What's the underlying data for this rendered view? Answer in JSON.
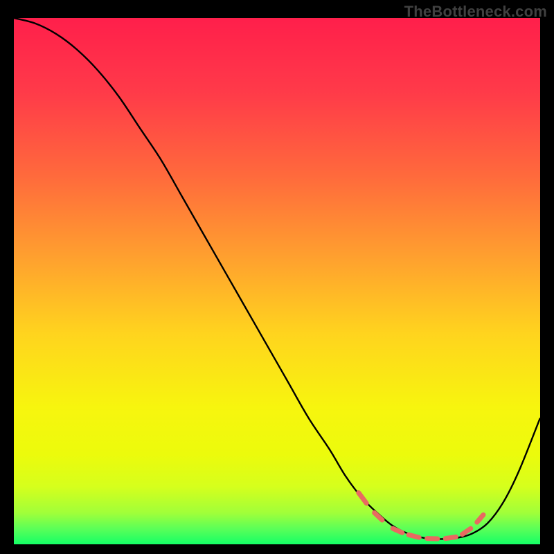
{
  "watermark": "TheBottleneck.com",
  "gradient_stops": [
    {
      "offset": 0,
      "color": "#ff1f4b"
    },
    {
      "offset": 14,
      "color": "#ff3a49"
    },
    {
      "offset": 30,
      "color": "#ff6a3c"
    },
    {
      "offset": 46,
      "color": "#ffa22e"
    },
    {
      "offset": 60,
      "color": "#ffd41e"
    },
    {
      "offset": 74,
      "color": "#f7f50e"
    },
    {
      "offset": 83,
      "color": "#ecfb0c"
    },
    {
      "offset": 89,
      "color": "#d6ff1c"
    },
    {
      "offset": 94,
      "color": "#a1ff39"
    },
    {
      "offset": 97,
      "color": "#5cff58"
    },
    {
      "offset": 100,
      "color": "#14ff66"
    }
  ],
  "chart_data": {
    "type": "line",
    "title": "",
    "xlabel": "",
    "ylabel": "",
    "xlim": [
      0,
      100
    ],
    "ylim": [
      0,
      100
    ],
    "grid": false,
    "legend": false,
    "series": [
      {
        "name": "bottleneck-curve",
        "x": [
          0,
          4,
          8,
          12,
          16,
          20,
          24,
          28,
          32,
          36,
          40,
          44,
          48,
          52,
          56,
          60,
          63,
          66,
          69,
          72,
          75,
          78,
          81,
          84,
          87,
          90,
          93,
          96,
          100
        ],
        "y": [
          100,
          99,
          97,
          94,
          90,
          85,
          79,
          73,
          66,
          59,
          52,
          45,
          38,
          31,
          24,
          18,
          13,
          9,
          6,
          3.5,
          2,
          1.2,
          1,
          1.2,
          2,
          4,
          8,
          14,
          24
        ]
      }
    ],
    "markers": {
      "name": "optimal-range-dashes",
      "color": "#e86a61",
      "segments": [
        {
          "x1": 65.5,
          "y1": 9.8,
          "x2": 67.0,
          "y2": 7.8
        },
        {
          "x1": 68.5,
          "y1": 6.0,
          "x2": 70.0,
          "y2": 4.6
        },
        {
          "x1": 72.0,
          "y1": 3.0,
          "x2": 73.8,
          "y2": 2.2
        },
        {
          "x1": 75.0,
          "y1": 1.8,
          "x2": 77.0,
          "y2": 1.3
        },
        {
          "x1": 78.5,
          "y1": 1.1,
          "x2": 80.5,
          "y2": 1.05
        },
        {
          "x1": 82.0,
          "y1": 1.1,
          "x2": 84.0,
          "y2": 1.4
        },
        {
          "x1": 85.2,
          "y1": 1.9,
          "x2": 86.8,
          "y2": 3.0
        },
        {
          "x1": 88.0,
          "y1": 4.2,
          "x2": 89.2,
          "y2": 5.6
        }
      ]
    }
  }
}
